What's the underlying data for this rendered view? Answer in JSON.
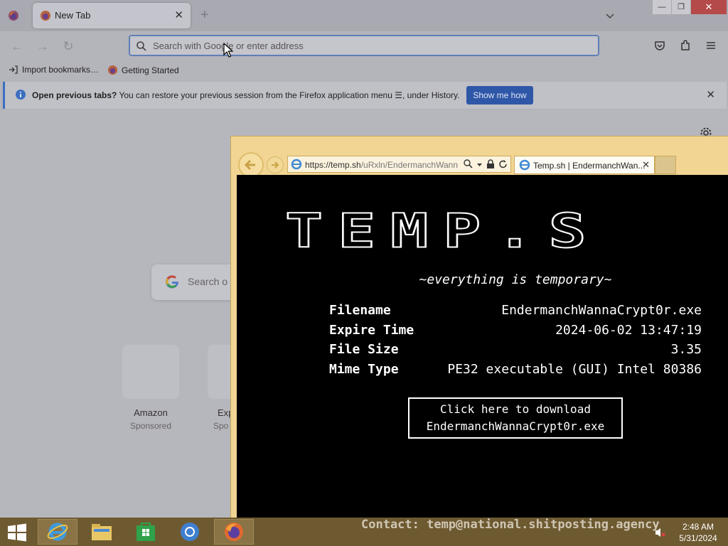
{
  "firefox": {
    "tab_title": "New Tab",
    "tab_close": "✕",
    "new_tab": "+",
    "window_controls": {
      "minimize": "—",
      "restore": "❐",
      "close": "✕"
    },
    "url_placeholder": "Search with Google or enter address",
    "bookmarks": [
      {
        "label": "Import bookmarks…",
        "icon": "import-icon"
      },
      {
        "label": "Getting Started",
        "icon": "firefox-icon"
      }
    ],
    "infobar": {
      "bold_text": "Open previous tabs?",
      "text": " You can restore your previous session from the Firefox application menu",
      "text_after": ", under History.",
      "button": "Show me how",
      "close": "✕"
    },
    "newtab": {
      "search_text": "Search o",
      "tiles": [
        {
          "name": "Amazon",
          "sub": "Sponsored"
        },
        {
          "name": "Exp",
          "sub": "Spo"
        }
      ]
    }
  },
  "ie": {
    "url_host": "https://temp.sh",
    "url_path": "/uRxln/EndermanchWann",
    "tab_title": "Temp.sh | EndermanchWan...",
    "tab_close": "✕",
    "page": {
      "logo": "TEMP.S",
      "tagline": "~everything is temporary~",
      "rows": [
        {
          "key": "Filename",
          "value": "EndermanchWannaCrypt0r.exe"
        },
        {
          "key": "Expire Time",
          "value": "2024-06-02 13:47:19"
        },
        {
          "key": "File Size",
          "value": "3.35"
        },
        {
          "key": "Mime Type",
          "value": "PE32 executable (GUI) Intel 80386"
        }
      ],
      "download_line1": "Click here to download",
      "download_line2": "EndermanchWannaCrypt0r.exe"
    }
  },
  "taskbar": {
    "contact": "Contact: temp@national.shitposting.agency",
    "time": "2:48 AM",
    "date": "5/31/2024",
    "apps": [
      "internet-explorer",
      "file-explorer",
      "store",
      "chrome",
      "firefox"
    ]
  },
  "colors": {
    "accent": "#2f57a8",
    "ie_frame": "#f2d593",
    "taskbar": "#6e5a31"
  }
}
